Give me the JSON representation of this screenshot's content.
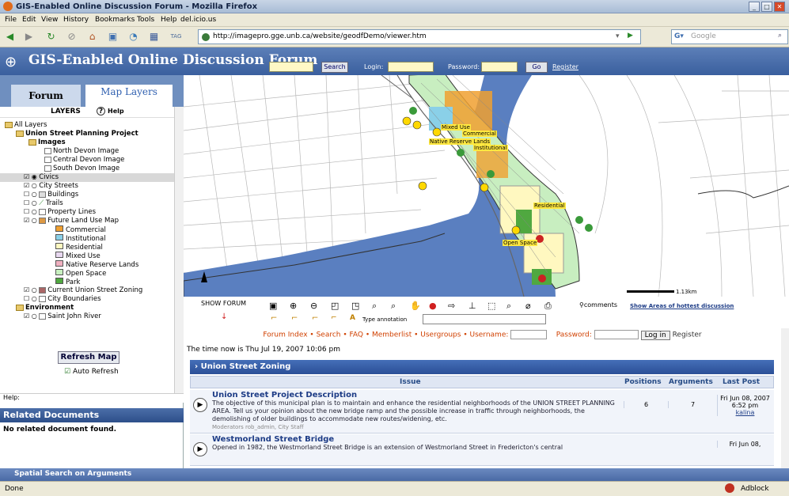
{
  "window": {
    "title": "GIS-Enabled Online Discussion Forum - Mozilla Firefox"
  },
  "menu": [
    "File",
    "Edit",
    "View",
    "History",
    "Bookmarks",
    "Tools",
    "Help",
    "del.icio.us"
  ],
  "nav": {
    "url": "http://imagepro.gge.unb.ca/website/geodfDemo/viewer.htm",
    "search_placeholder": "Google"
  },
  "header": {
    "title": "GIS-Enabled Online Discussion Forum",
    "search_btn": "Search",
    "login_label": "Login:",
    "password_label": "Password:",
    "go_btn": "Go",
    "register_link": "Register"
  },
  "left": {
    "tabs": {
      "forum": "Forum",
      "map_layers": "Map Layers"
    },
    "layers_title": "LAYERS",
    "help_link": "Help",
    "tree": {
      "all_layers": "All Layers",
      "project": "Union Street Planning Project",
      "images": "Images",
      "north": "North Devon Image",
      "central": "Central Devon Image",
      "south": "South Devon Image",
      "civics": "Civics",
      "streets": "City Streets",
      "buildings": "Buildings",
      "trails": "Trails",
      "property": "Property Lines",
      "future": "Future Land Use Map",
      "legend": [
        "Commercial",
        "Institutional",
        "Residential",
        "Mixed Use",
        "Native Reserve Lands",
        "Open Space",
        "Park"
      ],
      "zoning": "Current Union Street Zoning",
      "boundaries": "City Boundaries",
      "environment": "Environment",
      "river": "Saint John River"
    },
    "refresh_btn": "Refresh Map",
    "auto_refresh": "Auto Refresh",
    "help_bar": "Help:",
    "related_docs": "Related Documents",
    "no_docs": "No related document found."
  },
  "map": {
    "labels": {
      "mixed": "Mixed Use",
      "commercial": "Commercial",
      "native": "Native Reserve Lands",
      "institutional": "Institutional",
      "residential": "Residential",
      "open": "Open Space"
    },
    "scale": "1.13km"
  },
  "toolbar": {
    "show_forum": "SHOW FORUM",
    "comments": "comments",
    "hottest": "Show Areas of hottest discussion",
    "annotation": "Type annotation"
  },
  "forum": {
    "nav": {
      "index": "Forum Index",
      "search": "Search",
      "faq": "FAQ",
      "members": "Memberlist",
      "groups": "Usergroups",
      "username": "Username:",
      "password": "Password:",
      "login": "Log in",
      "register": "Register"
    },
    "time": "The time now is Thu Jul 19, 2007 10:06 pm",
    "zone": "Union Street Zoning",
    "headers": {
      "issue": "Issue",
      "positions": "Positions",
      "arguments": "Arguments",
      "last": "Last Post"
    },
    "rows": [
      {
        "title": "Union Street Project Description",
        "desc": "The objective of this municipal plan is to maintain and enhance the residential neighborhoods of the UNION STREET PLANNING AREA. Tell us your opinion about the new bridge ramp and the possible increase in traffic through neighborhoods, the demolishing of older buildings to accommodate new routes/widening, etc.",
        "mods": "Moderators rob_admin, City Staff",
        "positions": "6",
        "arguments": "7",
        "last_date": "Fri Jun 08, 2007 6:52 pm",
        "last_user": "kalina"
      },
      {
        "title": "Westmorland Street Bridge",
        "desc": "Opened in 1982, the Westmorland Street Bridge is an extension of Westmorland Street in Fredericton's central",
        "mods": "",
        "positions": "",
        "arguments": "",
        "last_date": "Fri Jun 08,",
        "last_user": ""
      }
    ]
  },
  "spatial": "Spatial Search on Arguments",
  "status": {
    "text": "Done",
    "adblock": "Adblock"
  }
}
